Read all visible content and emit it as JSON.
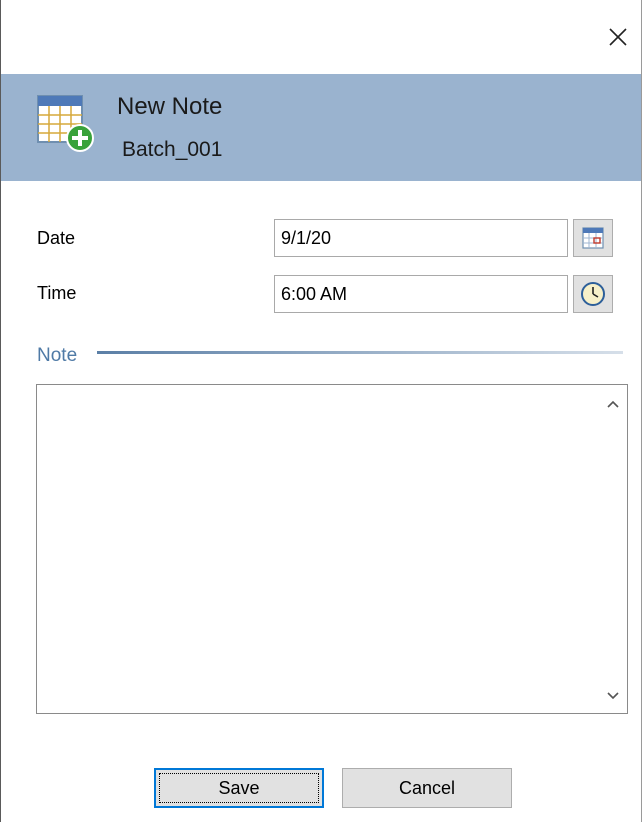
{
  "window": {
    "close_icon": "close-icon"
  },
  "header": {
    "title": "New Note",
    "subtitle": "Batch_001",
    "icon": "calendar-add-icon",
    "background": "#9ab3cf"
  },
  "form": {
    "date": {
      "label": "Date",
      "value": "9/1/20",
      "picker_icon": "calendar-icon"
    },
    "time": {
      "label": "Time",
      "value": "6:00 AM",
      "picker_icon": "clock-icon"
    }
  },
  "note": {
    "label": "Note",
    "value": "",
    "label_color": "#4f7aa6"
  },
  "buttons": {
    "save_label": "Save",
    "cancel_label": "Cancel"
  }
}
